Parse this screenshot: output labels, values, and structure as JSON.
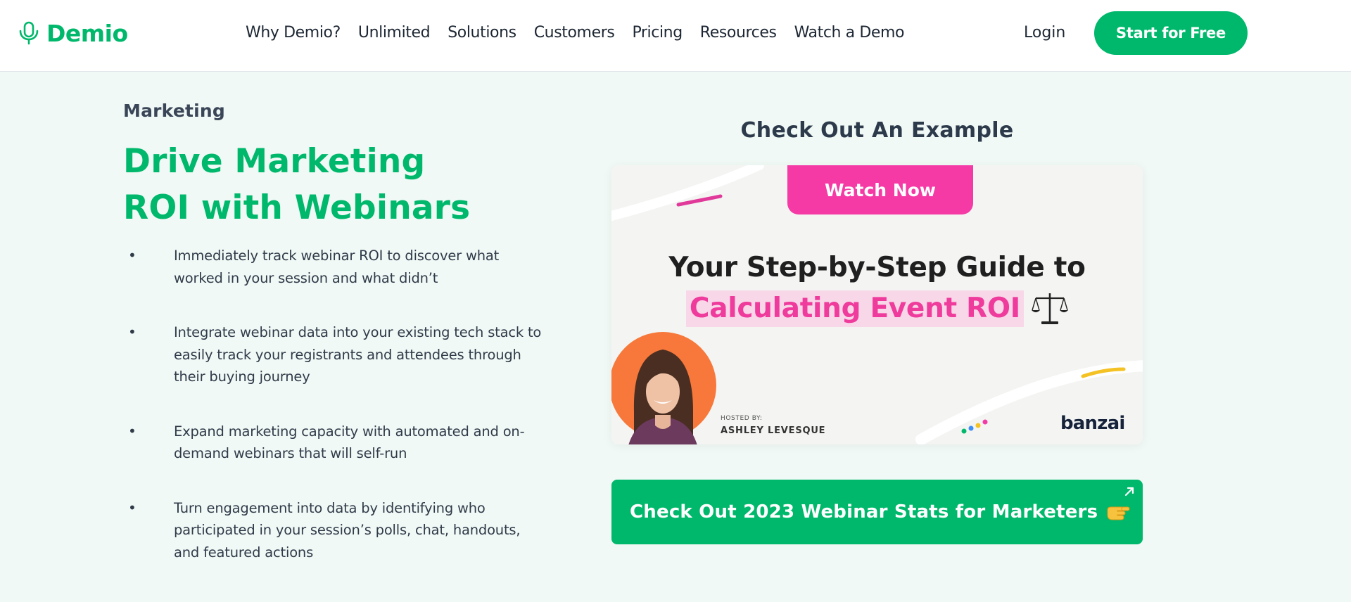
{
  "header": {
    "logo": {
      "text": "Demio",
      "icon": "microphone-logo-icon"
    },
    "nav": [
      "Why Demio?",
      "Unlimited",
      "Solutions",
      "Customers",
      "Pricing",
      "Resources",
      "Watch a Demo"
    ],
    "login_label": "Login",
    "cta_label": "Start for Free"
  },
  "main": {
    "eyebrow": "Marketing",
    "headline": [
      "Drive Marketing",
      "ROI with Webinars"
    ],
    "bullets": [
      "Immediately track webinar ROI to discover what worked in your session and what didn’t",
      "Integrate webinar data into your existing tech stack to easily track your registrants and attendees through their buying journey",
      "Expand marketing capacity with automated and on-demand webinars that will self-run",
      "Turn engagement into data by identifying who participated in your session’s polls, chat, handouts, and featured actions"
    ],
    "bullet_marker": "•"
  },
  "example": {
    "title": "Check Out An Example",
    "card": {
      "watch_label": "Watch Now",
      "title_line1": "Your Step-by-Step Guide to",
      "title_line2": "Calculating Event ROI",
      "title_icon": "balance-scale-icon",
      "hosted_by": "HOSTED BY:",
      "host_name": "ASHLEY LEVESQUE",
      "brand": "banzai"
    },
    "stats_button_label": "Check Out 2023 Webinar Stats for Marketers",
    "stats_button_icons": [
      "pointing-hand-icon",
      "external-link-icon"
    ]
  },
  "colors": {
    "brand_green": "#00b86b",
    "page_background": "#f1f9f6",
    "accent_pink": "#f53aa6",
    "avatar_orange": "#f7783a"
  }
}
